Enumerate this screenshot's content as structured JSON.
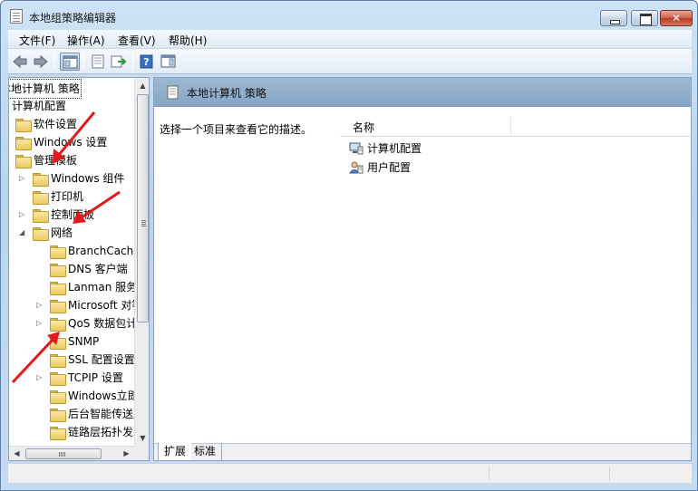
{
  "window": {
    "title": "本地组策略编辑器"
  },
  "menu": [
    {
      "label": "文件(F)"
    },
    {
      "label": "操作(A)"
    },
    {
      "label": "查看(V)"
    },
    {
      "label": "帮助(H)"
    }
  ],
  "toolbar": {
    "icons": [
      "back-icon",
      "forward-icon",
      "show-tree-icon",
      "properties-icon",
      "export-icon",
      "help-icon",
      "show-hide-action-pane-icon"
    ]
  },
  "tree": {
    "root": "本地计算机 策略",
    "items": [
      {
        "label": "计算机配置",
        "level": 0,
        "folder": false,
        "expander": ""
      },
      {
        "label": "软件设置",
        "level": 1,
        "folder": true,
        "expander": ""
      },
      {
        "label": "Windows 设置",
        "level": 1,
        "folder": true,
        "expander": ""
      },
      {
        "label": "管理模板",
        "level": 1,
        "folder": true,
        "expander": ""
      },
      {
        "label": "Windows 组件",
        "level": 2,
        "folder": true,
        "expander": "▷"
      },
      {
        "label": "打印机",
        "level": 2,
        "folder": true,
        "expander": ""
      },
      {
        "label": "控制面板",
        "level": 2,
        "folder": true,
        "expander": "▷"
      },
      {
        "label": "网络",
        "level": 2,
        "folder": true,
        "expander": "◢"
      },
      {
        "label": "BranchCache",
        "level": 3,
        "folder": true,
        "expander": ""
      },
      {
        "label": "DNS 客户端",
        "level": 3,
        "folder": true,
        "expander": ""
      },
      {
        "label": "Lanman 服务器",
        "level": 3,
        "folder": true,
        "expander": ""
      },
      {
        "label": "Microsoft 对等网络服务",
        "level": 3,
        "folder": true,
        "expander": "▷"
      },
      {
        "label": "QoS 数据包计划程序",
        "level": 3,
        "folder": true,
        "expander": "▷"
      },
      {
        "label": "SNMP",
        "level": 3,
        "folder": true,
        "expander": ""
      },
      {
        "label": "SSL 配置设置",
        "level": 3,
        "folder": true,
        "expander": ""
      },
      {
        "label": "TCPIP 设置",
        "level": 3,
        "folder": true,
        "expander": "▷"
      },
      {
        "label": "Windows立即连接",
        "level": 3,
        "folder": true,
        "expander": ""
      },
      {
        "label": "后台智能传送服务",
        "level": 3,
        "folder": true,
        "expander": ""
      },
      {
        "label": "链路层拓扑发现",
        "level": 3,
        "folder": true,
        "expander": ""
      }
    ]
  },
  "right": {
    "header": "本地计算机 策略",
    "description": "选择一个项目来查看它的描述。",
    "column_name": "名称",
    "rows": [
      {
        "label": "计算机配置",
        "icon": "computer-config-icon"
      },
      {
        "label": "用户配置",
        "icon": "user-config-icon"
      }
    ],
    "tabs": [
      {
        "label": "扩展"
      },
      {
        "label": "标准"
      }
    ]
  },
  "colors": {
    "annotation_arrow": "#e3191b",
    "header_blue": "#93afcc"
  }
}
